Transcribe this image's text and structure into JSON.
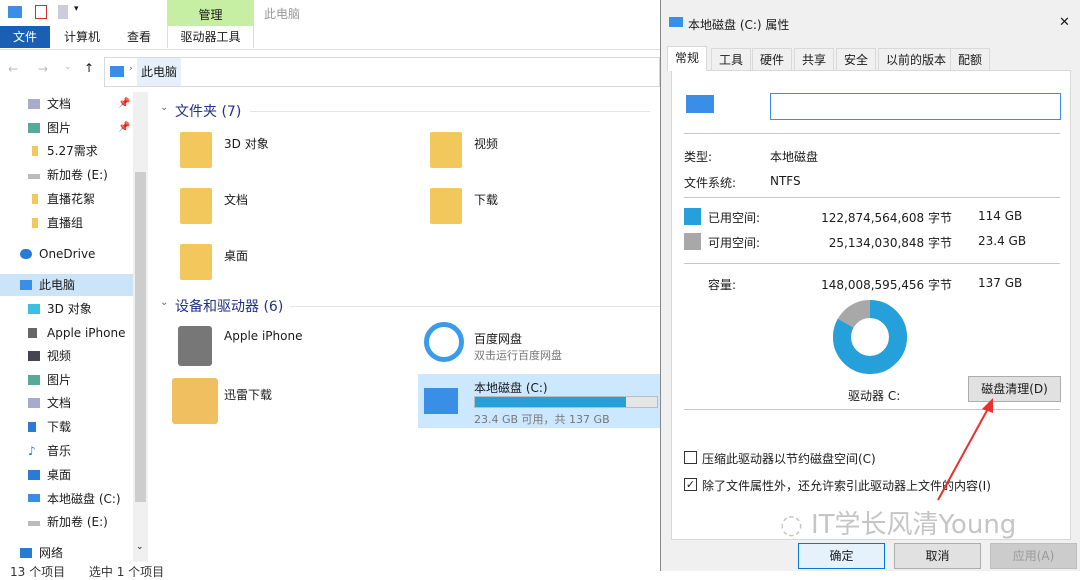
{
  "explorer": {
    "qa_title": "此电脑",
    "ribbon": {
      "file": "文件",
      "computer": "计算机",
      "view": "查看",
      "manage": "管理",
      "drive_tools": "驱动器工具"
    },
    "address": "此电脑",
    "sidebar": [
      {
        "label": "文档",
        "pinned": true
      },
      {
        "label": "图片",
        "pinned": true
      },
      {
        "label": "5.27需求"
      },
      {
        "label": "新加卷 (E:)"
      },
      {
        "label": "直播花絮"
      },
      {
        "label": "直播组"
      },
      {
        "label": "OneDrive"
      },
      {
        "label": "此电脑",
        "selected": true
      },
      {
        "label": "3D 对象"
      },
      {
        "label": "Apple iPhone"
      },
      {
        "label": "视频"
      },
      {
        "label": "图片"
      },
      {
        "label": "文档"
      },
      {
        "label": "下载"
      },
      {
        "label": "音乐"
      },
      {
        "label": "桌面"
      },
      {
        "label": "本地磁盘 (C:)"
      },
      {
        "label": "新加卷 (E:)"
      },
      {
        "label": "网络"
      }
    ],
    "folders_header": "文件夹 (7)",
    "folders": [
      "3D 对象",
      "视频",
      "文档",
      "下载",
      "桌面"
    ],
    "devices_header": "设备和驱动器 (6)",
    "devices": {
      "iphone": "Apple iPhone",
      "baidu": "百度网盘",
      "baidu_sub": "双击运行百度网盘",
      "xunlei": "迅雷下载",
      "c_name": "本地磁盘 (C:)",
      "c_info": "23.4 GB 可用，共 137 GB",
      "c_used_pct": 83
    },
    "status": {
      "count": "13 个项目",
      "selected": "选中 1 个项目"
    }
  },
  "dialog": {
    "title": "本地磁盘 (C:) 属性",
    "close": "✕",
    "tabs": [
      "常规",
      "工具",
      "硬件",
      "共享",
      "安全",
      "以前的版本",
      "配额"
    ],
    "name_value": "",
    "type_label": "类型:",
    "type_value": "本地磁盘",
    "fs_label": "文件系统:",
    "fs_value": "NTFS",
    "used_label": "已用空间:",
    "used_bytes": "122,874,564,608 字节",
    "used_gb": "114 GB",
    "free_label": "可用空间:",
    "free_bytes": "25,134,030,848 字节",
    "free_gb": "23.4 GB",
    "cap_label": "容量:",
    "cap_bytes": "148,008,595,456 字节",
    "cap_gb": "137 GB",
    "drive_label": "驱动器 C:",
    "cleanup": "磁盘清理(D)",
    "compress": "压缩此驱动器以节约磁盘空间(C)",
    "index": "除了文件属性外，还允许索引此驱动器上文件的内容(I)",
    "ok": "确定",
    "cancel": "取消",
    "apply": "应用(A)",
    "colors": {
      "used": "#26a0da",
      "free": "#a8a8a8"
    }
  },
  "watermark": "IT学长风清Young"
}
